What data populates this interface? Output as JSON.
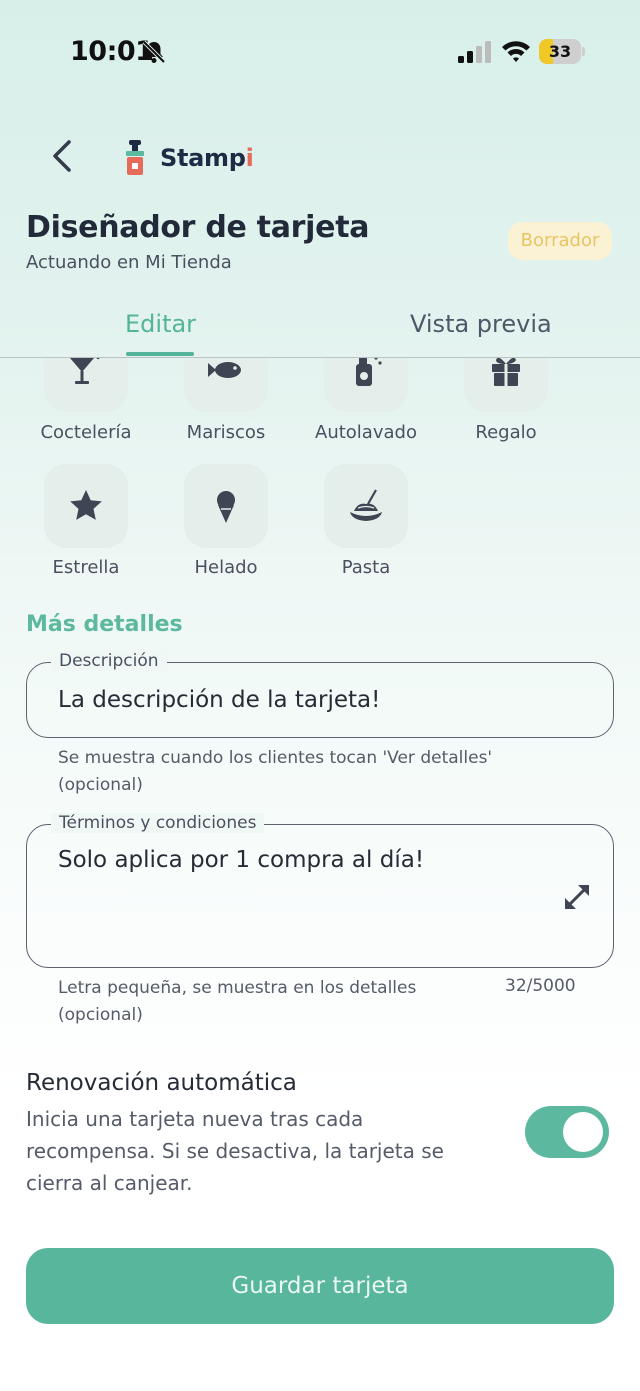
{
  "status_bar": {
    "time": "10:01",
    "battery": "33",
    "battery_level": 0.33
  },
  "header": {
    "logo_text_main": "Stamp",
    "logo_text_accent": "i",
    "title": "Diseñador de tarjeta",
    "subtitle": "Actuando en Mi Tienda",
    "badge": "Borrador"
  },
  "tabs": [
    {
      "label": "Editar",
      "active": true
    },
    {
      "label": "Vista previa",
      "active": false
    }
  ],
  "icons_top": [
    {
      "label": "Coctelería",
      "icon": "cocktail-icon"
    },
    {
      "label": "Mariscos",
      "icon": "fish-icon"
    },
    {
      "label": "Autolavado",
      "icon": "car-wash-icon"
    },
    {
      "label": "Regalo",
      "icon": "gift-icon"
    }
  ],
  "icons_bottom": [
    {
      "label": "Estrella",
      "icon": "star-icon"
    },
    {
      "label": "Helado",
      "icon": "ice-cream-icon"
    },
    {
      "label": "Pasta",
      "icon": "pasta-icon"
    }
  ],
  "details": {
    "section_title": "Más detalles",
    "description": {
      "label": "Descripción",
      "value": "La descripción de la tarjeta!",
      "helper_1": "Se muestra cuando los clientes tocan 'Ver detalles'",
      "helper_2": "(opcional)"
    },
    "terms": {
      "label": "Términos y condiciones",
      "value": "Solo aplica por 1 compra al día!",
      "helper_1": "Letra pequeña, se muestra en los detalles",
      "helper_2": "(opcional)",
      "counter": "32/5000"
    }
  },
  "renewal": {
    "title": "Renovación automática",
    "description": "Inicia una tarjeta nueva tras cada recompensa. Si se desactiva, la tarjeta se cierra al canjear.",
    "enabled": true
  },
  "save_label": "Guardar tarjeta",
  "colors": {
    "accent": "#54b499",
    "badge_bg": "#fbf2d6",
    "badge_text": "#e9c462"
  }
}
